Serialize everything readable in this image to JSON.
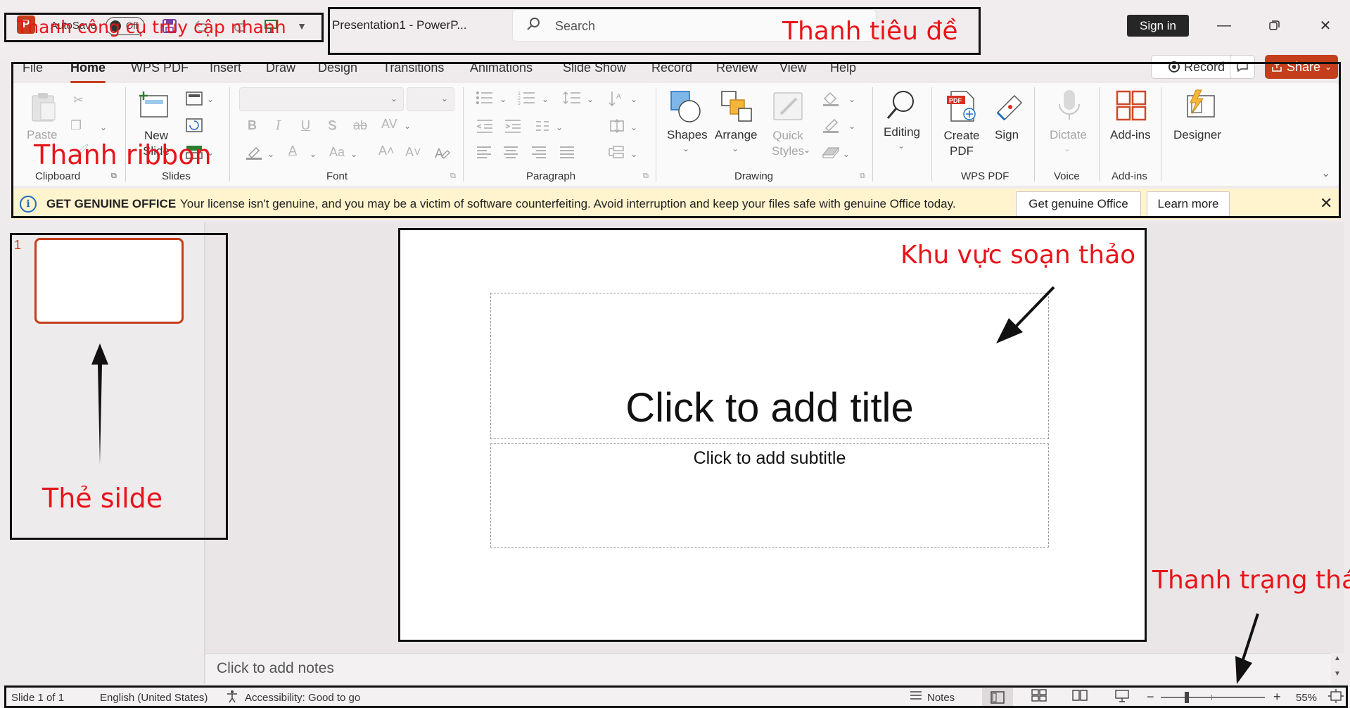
{
  "titlebar": {
    "app_logo": "P",
    "autosave_label": "AutoSave",
    "autosave_state": "Off",
    "doc_title": "Presentation1  -  PowerP...",
    "search_placeholder": "Search",
    "sign_in": "Sign in",
    "icons": [
      "save-icon",
      "undo-icon",
      "redo-icon",
      "present-icon",
      "customize-chevron-icon",
      "minimize-icon",
      "restore-icon",
      "close-icon"
    ]
  },
  "menu": {
    "tabs": [
      "File",
      "Home",
      "WPS PDF",
      "Insert",
      "Draw",
      "Design",
      "Transitions",
      "Animations",
      "Slide Show",
      "Record",
      "Review",
      "View",
      "Help"
    ],
    "active_tab": "Home",
    "record_button": "Record",
    "share_button": "Share"
  },
  "ribbon": {
    "clipboard": {
      "paste": "Paste",
      "group": "Clipboard"
    },
    "slides": {
      "new_slide": "New Slide",
      "group": "Slides"
    },
    "font": {
      "group": "Font",
      "bold": "B",
      "italic": "I",
      "underline": "U",
      "shadow": "S",
      "strike": "ab",
      "spacing": "AV",
      "font_color": "A",
      "case": "Aa",
      "grow": "A˄",
      "shrink": "A˅"
    },
    "paragraph": {
      "group": "Paragraph"
    },
    "drawing": {
      "shapes": "Shapes",
      "arrange": "Arrange",
      "quick_styles": "Quick Styles",
      "group": "Drawing"
    },
    "editing": {
      "label": "Editing"
    },
    "wps_pdf": {
      "create_pdf": "Create PDF",
      "sign": "Sign",
      "group": "WPS PDF"
    },
    "voice": {
      "dictate": "Dictate",
      "group": "Voice"
    },
    "addins": {
      "label": "Add-ins",
      "group": "Add-ins"
    },
    "designer": {
      "label": "Designer"
    }
  },
  "license_bar": {
    "title": "GET GENUINE OFFICE",
    "message": "Your license isn't genuine, and you may be a victim of software counterfeiting. Avoid interruption and keep your files safe with genuine Office today.",
    "button_get": "Get genuine Office",
    "button_learn": "Learn more"
  },
  "thumbnails": {
    "slide_number": "1"
  },
  "slide": {
    "title_placeholder": "Click to add title",
    "subtitle_placeholder": "Click to add subtitle",
    "notes_placeholder": "Click to add notes"
  },
  "statusbar": {
    "slide_info": "Slide 1 of 1",
    "language": "English (United States)",
    "accessibility": "Accessibility: Good to go",
    "notes": "Notes",
    "zoom_minus": "−",
    "zoom_plus": "+",
    "zoom_level": "55%"
  },
  "annotations": {
    "quick_access": "Thanh công cụ truy cập nhanh",
    "title_bar": "Thanh tiêu đề",
    "ribbon": "Thanh ribbon",
    "slide_tab": "Thẻ silde",
    "editing_area": "Khu vực soạn thảo",
    "status_bar": "Thanh trạng thái"
  },
  "colors": {
    "accent": "#c43e1c",
    "annotation_red": "#e8141a",
    "license_bg": "#fff4ce"
  }
}
